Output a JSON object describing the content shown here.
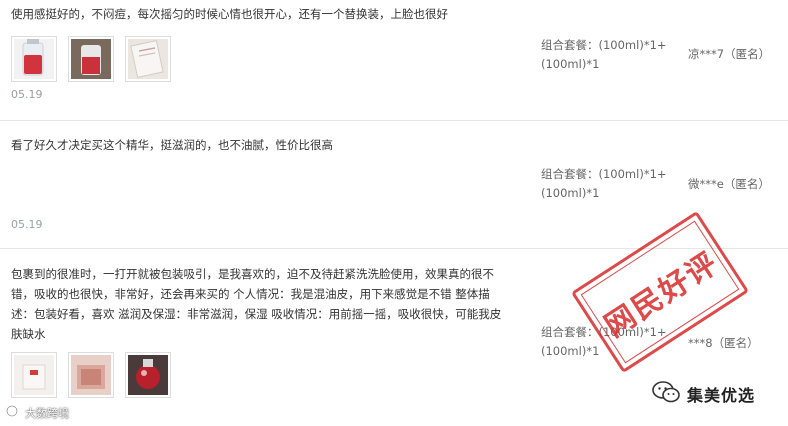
{
  "reviews": [
    {
      "content": "使用感挺好的，不闷痘，每次摇匀的时候心情也很开心，还有一个替换装，上脸也很好",
      "date": "05.19",
      "sku": "组合套餐：(100ml)*1+(100ml)*1",
      "user": "凉***7（匿名）"
    },
    {
      "content": "看了好久才决定买这个精华，挺滋润的，也不油腻，性价比很高",
      "date": "05.19",
      "sku": "组合套餐：(100ml)*1+(100ml)*1",
      "user": "微***e（匿名）"
    },
    {
      "content": "包裹到的很准时，一打开就被包装吸引，是我喜欢的，迫不及待赶紧洗洗脸使用，效果真的很不错，吸收的也很快，非常好，还会再来买的 个人情况：我是混油皮，用下来感觉是不错 整体描述：包装好看，喜欢 滋润及保湿：非常滋润，保湿 吸收情况：用前摇一摇，吸收很快，可能我皮肤缺水",
      "sku": "组合套餐：(100ml)*1+(100ml)*1",
      "user": "***8（匿名）"
    }
  ],
  "stamp": {
    "text": "网民好评",
    "color": "#d92a2a"
  },
  "watermark": {
    "wechat": "集美优选",
    "corner": "大数跨境"
  }
}
